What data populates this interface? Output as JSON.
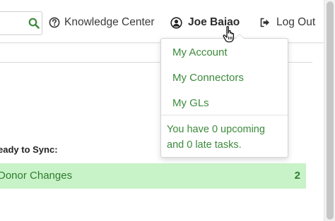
{
  "header": {
    "help_label": "Knowledge Center",
    "user_name": "Joe Baiao",
    "logout_label": "Log Out",
    "icons": {
      "search": "search-icon",
      "help": "question-circle-icon",
      "user": "user-circle-icon",
      "logout": "sign-out-icon"
    }
  },
  "user_menu": {
    "items": [
      {
        "label": "My Account"
      },
      {
        "label": "My Connectors"
      },
      {
        "label": "My GLs"
      }
    ],
    "tasks_line1": "You have 0 upcoming",
    "tasks_line2": "and 0 late tasks."
  },
  "content": {
    "ready_heading": "eady to Sync:",
    "sync_row": {
      "label": "Donor Changes",
      "count": "2"
    }
  },
  "colors": {
    "accent_green": "#3c8a3c",
    "row_highlight": "#c8f2c8"
  }
}
